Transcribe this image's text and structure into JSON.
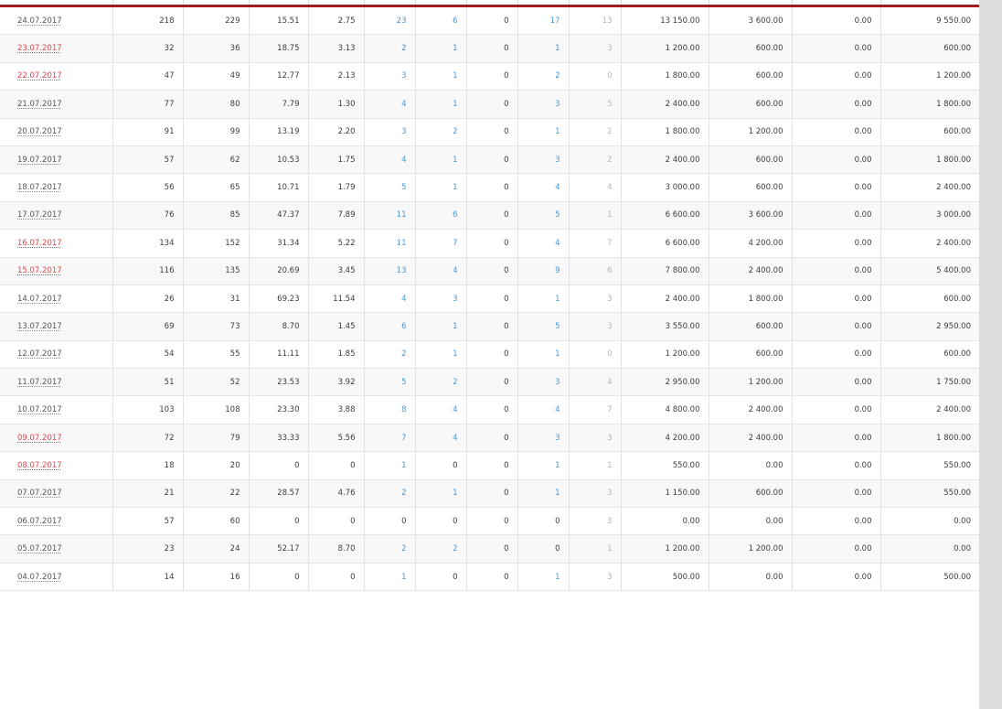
{
  "table": {
    "rows": [
      {
        "date": "24.07.2017",
        "weekend": false,
        "c1": "218",
        "c2": "229",
        "c3": "15.51",
        "c4": "2.75",
        "c5": "23",
        "c6": "6",
        "c7": "0",
        "c8": "17",
        "c9": "13",
        "c10": "13 150.00",
        "c11": "3 600.00",
        "c12": "0.00",
        "c13": "9 550.00"
      },
      {
        "date": "23.07.2017",
        "weekend": true,
        "c1": "32",
        "c2": "36",
        "c3": "18.75",
        "c4": "3.13",
        "c5": "2",
        "c6": "1",
        "c7": "0",
        "c8": "1",
        "c9": "3",
        "c10": "1 200.00",
        "c11": "600.00",
        "c12": "0.00",
        "c13": "600.00"
      },
      {
        "date": "22.07.2017",
        "weekend": true,
        "c1": "47",
        "c2": "49",
        "c3": "12.77",
        "c4": "2.13",
        "c5": "3",
        "c6": "1",
        "c7": "0",
        "c8": "2",
        "c9": "0",
        "c10": "1 800.00",
        "c11": "600.00",
        "c12": "0.00",
        "c13": "1 200.00"
      },
      {
        "date": "21.07.2017",
        "weekend": false,
        "c1": "77",
        "c2": "80",
        "c3": "7.79",
        "c4": "1.30",
        "c5": "4",
        "c6": "1",
        "c7": "0",
        "c8": "3",
        "c9": "5",
        "c10": "2 400.00",
        "c11": "600.00",
        "c12": "0.00",
        "c13": "1 800.00"
      },
      {
        "date": "20.07.2017",
        "weekend": false,
        "c1": "91",
        "c2": "99",
        "c3": "13.19",
        "c4": "2.20",
        "c5": "3",
        "c6": "2",
        "c7": "0",
        "c8": "1",
        "c9": "2",
        "c10": "1 800.00",
        "c11": "1 200.00",
        "c12": "0.00",
        "c13": "600.00"
      },
      {
        "date": "19.07.2017",
        "weekend": false,
        "c1": "57",
        "c2": "62",
        "c3": "10.53",
        "c4": "1.75",
        "c5": "4",
        "c6": "1",
        "c7": "0",
        "c8": "3",
        "c9": "2",
        "c10": "2 400.00",
        "c11": "600.00",
        "c12": "0.00",
        "c13": "1 800.00"
      },
      {
        "date": "18.07.2017",
        "weekend": false,
        "c1": "56",
        "c2": "65",
        "c3": "10.71",
        "c4": "1.79",
        "c5": "5",
        "c6": "1",
        "c7": "0",
        "c8": "4",
        "c9": "4",
        "c10": "3 000.00",
        "c11": "600.00",
        "c12": "0.00",
        "c13": "2 400.00"
      },
      {
        "date": "17.07.2017",
        "weekend": false,
        "c1": "76",
        "c2": "85",
        "c3": "47.37",
        "c4": "7.89",
        "c5": "11",
        "c6": "6",
        "c7": "0",
        "c8": "5",
        "c9": "1",
        "c10": "6 600.00",
        "c11": "3 600.00",
        "c12": "0.00",
        "c13": "3 000.00"
      },
      {
        "date": "16.07.2017",
        "weekend": true,
        "c1": "134",
        "c2": "152",
        "c3": "31.34",
        "c4": "5.22",
        "c5": "11",
        "c6": "7",
        "c7": "0",
        "c8": "4",
        "c9": "7",
        "c10": "6 600.00",
        "c11": "4 200.00",
        "c12": "0.00",
        "c13": "2 400.00"
      },
      {
        "date": "15.07.2017",
        "weekend": true,
        "c1": "116",
        "c2": "135",
        "c3": "20.69",
        "c4": "3.45",
        "c5": "13",
        "c6": "4",
        "c7": "0",
        "c8": "9",
        "c9": "6",
        "c10": "7 800.00",
        "c11": "2 400.00",
        "c12": "0.00",
        "c13": "5 400.00"
      },
      {
        "date": "14.07.2017",
        "weekend": false,
        "c1": "26",
        "c2": "31",
        "c3": "69.23",
        "c4": "11.54",
        "c5": "4",
        "c6": "3",
        "c7": "0",
        "c8": "1",
        "c9": "3",
        "c10": "2 400.00",
        "c11": "1 800.00",
        "c12": "0.00",
        "c13": "600.00"
      },
      {
        "date": "13.07.2017",
        "weekend": false,
        "c1": "69",
        "c2": "73",
        "c3": "8.70",
        "c4": "1.45",
        "c5": "6",
        "c6": "1",
        "c7": "0",
        "c8": "5",
        "c9": "3",
        "c10": "3 550.00",
        "c11": "600.00",
        "c12": "0.00",
        "c13": "2 950.00"
      },
      {
        "date": "12.07.2017",
        "weekend": false,
        "c1": "54",
        "c2": "55",
        "c3": "11.11",
        "c4": "1.85",
        "c5": "2",
        "c6": "1",
        "c7": "0",
        "c8": "1",
        "c9": "0",
        "c10": "1 200.00",
        "c11": "600.00",
        "c12": "0.00",
        "c13": "600.00"
      },
      {
        "date": "11.07.2017",
        "weekend": false,
        "c1": "51",
        "c2": "52",
        "c3": "23.53",
        "c4": "3.92",
        "c5": "5",
        "c6": "2",
        "c7": "0",
        "c8": "3",
        "c9": "4",
        "c10": "2 950.00",
        "c11": "1 200.00",
        "c12": "0.00",
        "c13": "1 750.00"
      },
      {
        "date": "10.07.2017",
        "weekend": false,
        "c1": "103",
        "c2": "108",
        "c3": "23.30",
        "c4": "3.88",
        "c5": "8",
        "c6": "4",
        "c7": "0",
        "c8": "4",
        "c9": "7",
        "c10": "4 800.00",
        "c11": "2 400.00",
        "c12": "0.00",
        "c13": "2 400.00"
      },
      {
        "date": "09.07.2017",
        "weekend": true,
        "c1": "72",
        "c2": "79",
        "c3": "33.33",
        "c4": "5.56",
        "c5": "7",
        "c6": "4",
        "c7": "0",
        "c8": "3",
        "c9": "3",
        "c10": "4 200.00",
        "c11": "2 400.00",
        "c12": "0.00",
        "c13": "1 800.00"
      },
      {
        "date": "08.07.2017",
        "weekend": true,
        "c1": "18",
        "c2": "20",
        "c3": "0",
        "c4": "0",
        "c5": "1",
        "c6": "0",
        "c7": "0",
        "c8": "1",
        "c9": "1",
        "c10": "550.00",
        "c11": "0.00",
        "c12": "0.00",
        "c13": "550.00"
      },
      {
        "date": "07.07.2017",
        "weekend": false,
        "c1": "21",
        "c2": "22",
        "c3": "28.57",
        "c4": "4.76",
        "c5": "2",
        "c6": "1",
        "c7": "0",
        "c8": "1",
        "c9": "3",
        "c10": "1 150.00",
        "c11": "600.00",
        "c12": "0.00",
        "c13": "550.00"
      },
      {
        "date": "06.07.2017",
        "weekend": false,
        "c1": "57",
        "c2": "60",
        "c3": "0",
        "c4": "0",
        "c5": "0",
        "c6": "0",
        "c7": "0",
        "c8": "0",
        "c9": "3",
        "c10": "0.00",
        "c11": "0.00",
        "c12": "0.00",
        "c13": "0.00"
      },
      {
        "date": "05.07.2017",
        "weekend": false,
        "c1": "23",
        "c2": "24",
        "c3": "52.17",
        "c4": "8.70",
        "c5": "2",
        "c6": "2",
        "c7": "0",
        "c8": "0",
        "c9": "1",
        "c10": "1 200.00",
        "c11": "1 200.00",
        "c12": "0.00",
        "c13": "0.00"
      },
      {
        "date": "04.07.2017",
        "weekend": false,
        "c1": "14",
        "c2": "16",
        "c3": "0",
        "c4": "0",
        "c5": "1",
        "c6": "0",
        "c7": "0",
        "c8": "1",
        "c9": "3",
        "c10": "500.00",
        "c11": "0.00",
        "c12": "0.00",
        "c13": "500.00"
      }
    ]
  },
  "colors": {
    "header_accent": "#a11d1d",
    "weekend_date": "#e0474c",
    "link_blue": "#4a97cf",
    "muted": "#b5b5b5",
    "scrollbar": "#dcdcdc"
  }
}
